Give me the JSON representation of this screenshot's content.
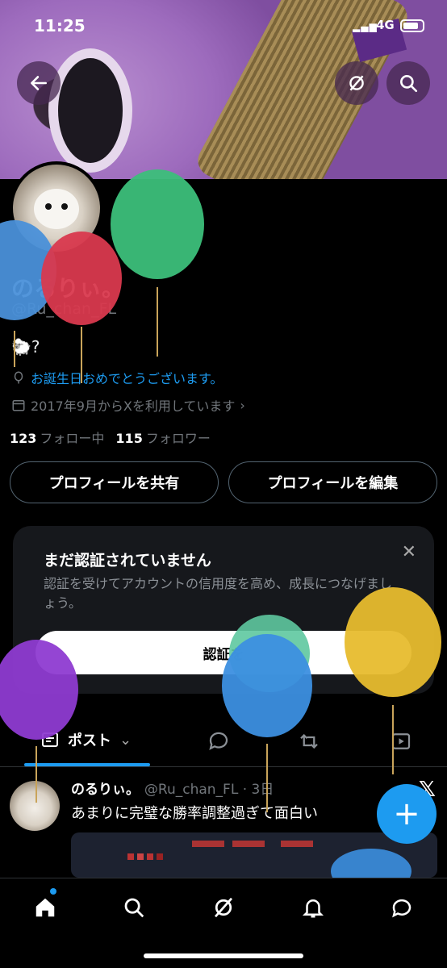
{
  "status_bar": {
    "time": "11:25",
    "network": "4G"
  },
  "profile": {
    "display_name": "のるりぃ。",
    "handle": "@Ru_chan_FL",
    "bio_emoji": "🐑?",
    "birthday_text": "お誕生日おめでとうございます。",
    "joined_text": "2017年9月からXを利用しています",
    "following_count": "123",
    "following_label": "フォロー中",
    "followers_count": "115",
    "followers_label": "フォロワー"
  },
  "actions": {
    "share_profile": "プロフィールを共有",
    "edit_profile": "プロフィールを編集"
  },
  "verify_card": {
    "title": "まだ認証されていません",
    "description": "認証を受けてアカウントの信用度を高め、成長につなげましょう。",
    "cta": "認証を"
  },
  "tabs": {
    "posts": "ポスト"
  },
  "post": {
    "author": "のるりぃ。",
    "meta": "@Ru_chan_FL · 3日",
    "text": "あまりに完璧な勝率調整過ぎて面白い"
  },
  "balloons": [
    {
      "color": "#4a90d9"
    },
    {
      "color": "#d9394e"
    },
    {
      "color": "#3cbf7a"
    },
    {
      "color": "#8e3bd1"
    },
    {
      "color": "#5ec8a0"
    },
    {
      "color": "#3c8fe0"
    },
    {
      "color": "#e7bc2e"
    },
    {
      "color": "#3c8fe0"
    }
  ],
  "colors": {
    "accent": "#1d9bf0",
    "background": "#000000"
  }
}
